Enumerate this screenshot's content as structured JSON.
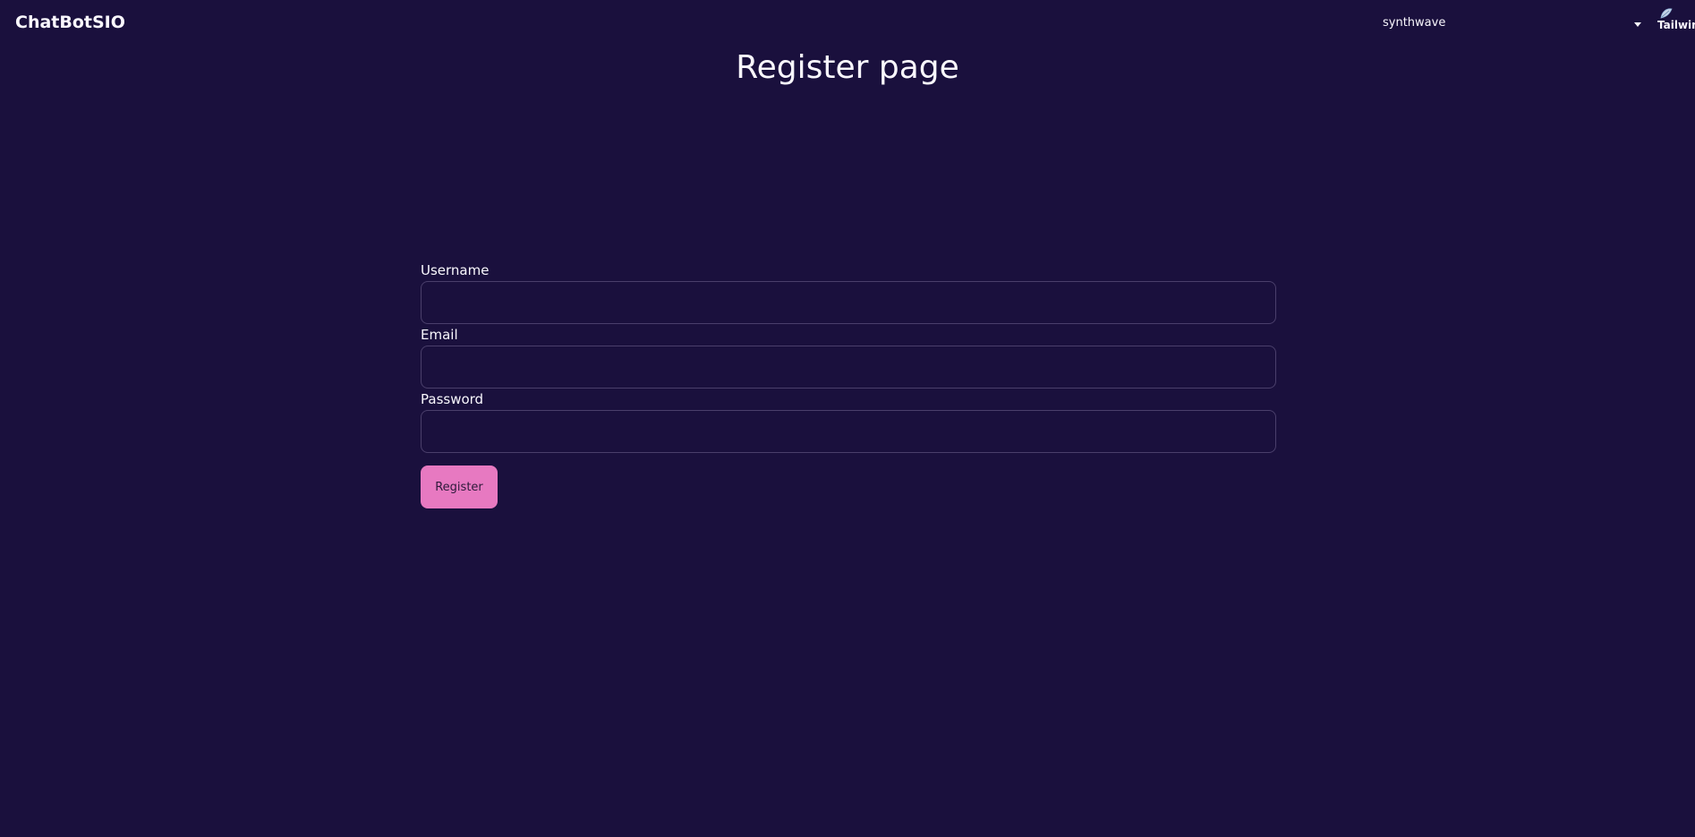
{
  "navbar": {
    "brand": "ChatBotSIO",
    "theme_select": {
      "value": "synthwave",
      "icon": "chevron-down-icon"
    },
    "logo": {
      "text": "Tailwind CSS",
      "icon": "tailwind-leaf-icon"
    }
  },
  "page": {
    "title": "Register page"
  },
  "form": {
    "username_label": "Username",
    "username_value": "",
    "email_label": "Email",
    "email_value": "",
    "password_label": "Password",
    "password_value": "",
    "submit_label": "Register"
  },
  "colors": {
    "background": "#1a103d",
    "text": "#f9f7fd",
    "input_border": "#4a3f6b",
    "primary_button": "#e779c1"
  }
}
